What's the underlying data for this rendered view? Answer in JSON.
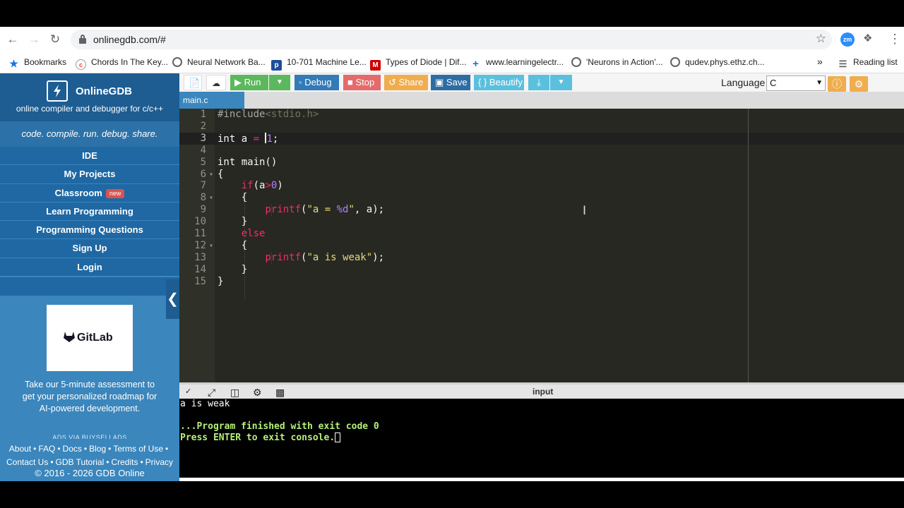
{
  "browser": {
    "url": "onlinegdb.com/#",
    "bookmarks": [
      {
        "label": "Bookmarks",
        "icon": "star-icon"
      },
      {
        "label": "Chords In The Key...",
        "icon": "chords-favicon"
      },
      {
        "label": "Neural Network Ba...",
        "icon": "globe-icon"
      },
      {
        "label": "10-701 Machine Le...",
        "icon": "p-favicon"
      },
      {
        "label": "Types of Diode | Dif...",
        "icon": "m-favicon"
      },
      {
        "label": "www.learningelectr...",
        "icon": "plus-favicon"
      },
      {
        "label": "'Neurons in Action'...",
        "icon": "globe-icon"
      },
      {
        "label": "qudev.phys.ethz.ch...",
        "icon": "globe-icon"
      }
    ],
    "overflow": "»",
    "reading_list": "Reading list",
    "ext_label": "zm"
  },
  "sidebar": {
    "brand": "OnlineGDB",
    "subtitle": "online compiler and debugger for c/c++",
    "tagline": "code. compile. run. debug. share.",
    "nav": [
      {
        "label": "IDE"
      },
      {
        "label": "My Projects"
      },
      {
        "label": "Classroom",
        "badge": "new"
      },
      {
        "label": "Learn Programming"
      },
      {
        "label": "Programming Questions"
      },
      {
        "label": "Sign Up"
      },
      {
        "label": "Login"
      }
    ],
    "ad_logo_text": "GitLab",
    "ad_text": "Take our 5-minute assessment to get your personalized roadmap for AI-powered development.",
    "ads_via": "ADS VIA BUYSELLADS",
    "footer_links": [
      "About",
      "FAQ",
      "Docs",
      "Blog",
      "Terms of Use",
      "Contact Us",
      "GDB Tutorial",
      "Credits",
      "Privacy"
    ],
    "copyright": "© 2016 - 2026 GDB Online"
  },
  "toolbar": {
    "run": "Run",
    "debug": "Debug",
    "stop": "Stop",
    "share": "Share",
    "save": "Save",
    "beautify": "{ } Beautify",
    "language_label": "Language",
    "language_value": "C",
    "colors": {
      "run": "#5cb85c",
      "debug": "#337ab7",
      "stop": "#e56a6a",
      "share": "#f0ad4e",
      "save": "#2e6da4",
      "beautify": "#5bc0de",
      "download": "#5bc0de"
    }
  },
  "editor": {
    "filename": "main.c",
    "lines": [
      "#include<stdio.h>",
      "",
      "int a = 1;",
      "",
      "int main()",
      "{",
      "    if(a>0)",
      "    {",
      "        printf(\"a = %d\", a);",
      "    }",
      "    else",
      "    {",
      "        printf(\"a is weak\");",
      "    }",
      "}"
    ],
    "line_numbers": [
      "1",
      "2",
      "3",
      "4",
      "5",
      "6",
      "7",
      "8",
      "9",
      "10",
      "11",
      "12",
      "13",
      "14",
      "15"
    ]
  },
  "console": {
    "input_label": "input",
    "output": [
      "a is weak",
      "",
      "...Program finished with exit code 0",
      "Press ENTER to exit console."
    ]
  }
}
